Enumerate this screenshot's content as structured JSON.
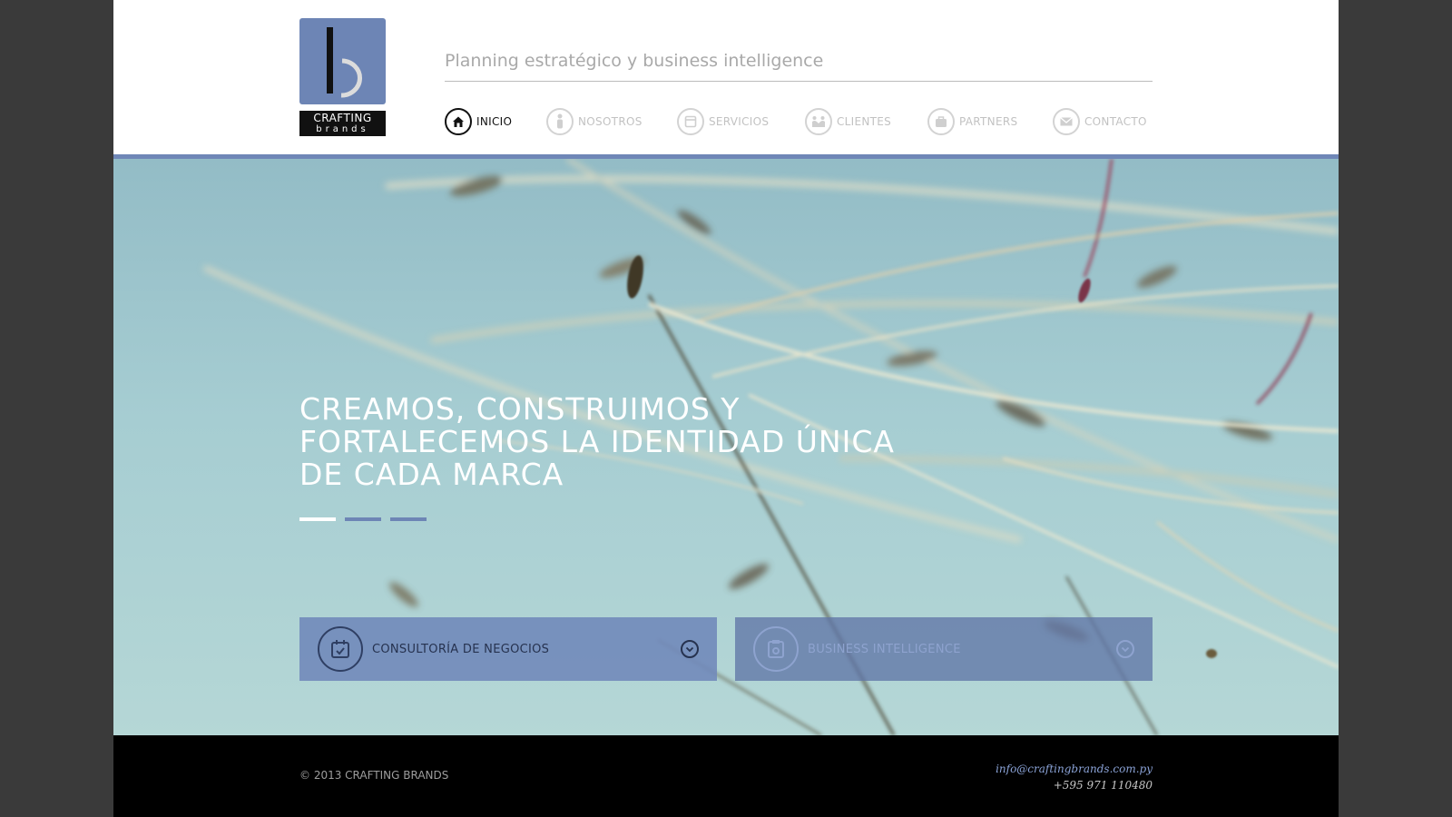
{
  "brand": {
    "logo_line1": "CRAFTING",
    "logo_line2": "brands",
    "tagline": "Planning estratégico y business intelligence"
  },
  "nav": {
    "items": [
      {
        "label": "INICIO",
        "icon": "home-icon",
        "active": true
      },
      {
        "label": "NOSOTROS",
        "icon": "person-icon",
        "active": false
      },
      {
        "label": "SERVICIOS",
        "icon": "services-icon",
        "active": false
      },
      {
        "label": "CLIENTES",
        "icon": "handshake-icon",
        "active": false
      },
      {
        "label": "PARTNERS",
        "icon": "briefcase-icon",
        "active": false
      },
      {
        "label": "CONTACTO",
        "icon": "envelope-icon",
        "active": false
      }
    ]
  },
  "hero": {
    "headline_lines": [
      "Creamos, construimos y",
      "fortalecemos la identidad única",
      "de cada marca"
    ],
    "slides_total": 3,
    "active_slide": 1
  },
  "services": [
    {
      "label": "Consultoría de negocios",
      "icon": "calendar-check-icon"
    },
    {
      "label": "Business Intelligence",
      "icon": "document-icon"
    }
  ],
  "footer": {
    "copyright": "© 2013 CRAFTING BRANDS",
    "email": "info@craftingbrands.com.py",
    "phone": "+595 971 110480"
  },
  "colors": {
    "accent": "#6d85b5",
    "background": "#3a3a3a",
    "footer": "#000000"
  }
}
